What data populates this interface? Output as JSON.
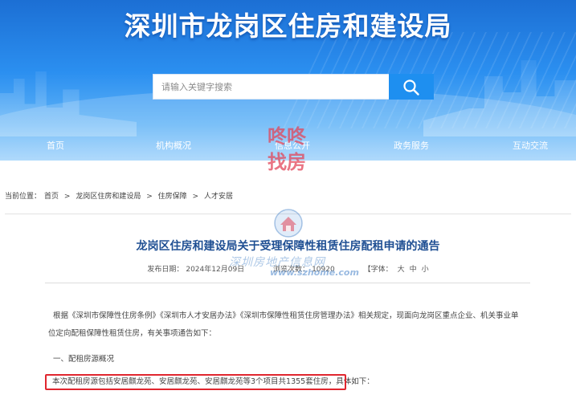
{
  "header": {
    "site_title": "深圳市龙岗区住房和建设局",
    "search_placeholder": "请输入关键字搜索",
    "nav": [
      "首页",
      "机构概况",
      "信息公开",
      "政务服务",
      "互动交流"
    ]
  },
  "watermark": {
    "logo_line1": "咚咚",
    "logo_line2": "找房",
    "site_name": "深圳房地产信息网",
    "site_url": "www.szhome.com"
  },
  "breadcrumb": {
    "prefix": "当前位置：",
    "items": [
      "首页",
      "龙岗区住房和建设局",
      "住房保障",
      "人才安居"
    ],
    "separator": ">"
  },
  "article": {
    "title": "龙岗区住房和建设局关于受理保障性租赁住房配租申请的通告",
    "meta": {
      "publish_label": "发布日期：",
      "publish_date": "2024年12月09日",
      "views_label": "浏览次数：",
      "views": "10920",
      "font_label": "【字体：",
      "font_sizes": [
        "大",
        "中",
        "小"
      ],
      "font_end": ""
    },
    "paragraph1_line1": "根据《深圳市保障性住房条例》《深圳市人才安居办法》《深圳市保障性租赁住房管理办法》相关规定，现面向龙岗区重点企业、机关事业单",
    "paragraph1_line2": "位定向配租保障性租赁住房，有关事项通告如下：",
    "section1": "一、配租房源概况",
    "highlight": "本次配租房源包括安居麒龙苑、安居麒龙苑、安居麒龙苑等3个项目共1355套住房，",
    "highlight_tail": "具体如下："
  },
  "colors": {
    "banner_top": "#1c6fd4",
    "title_blue": "#1f4f93",
    "search_button": "#1e8ff0",
    "highlight_border": "#e0262f"
  }
}
